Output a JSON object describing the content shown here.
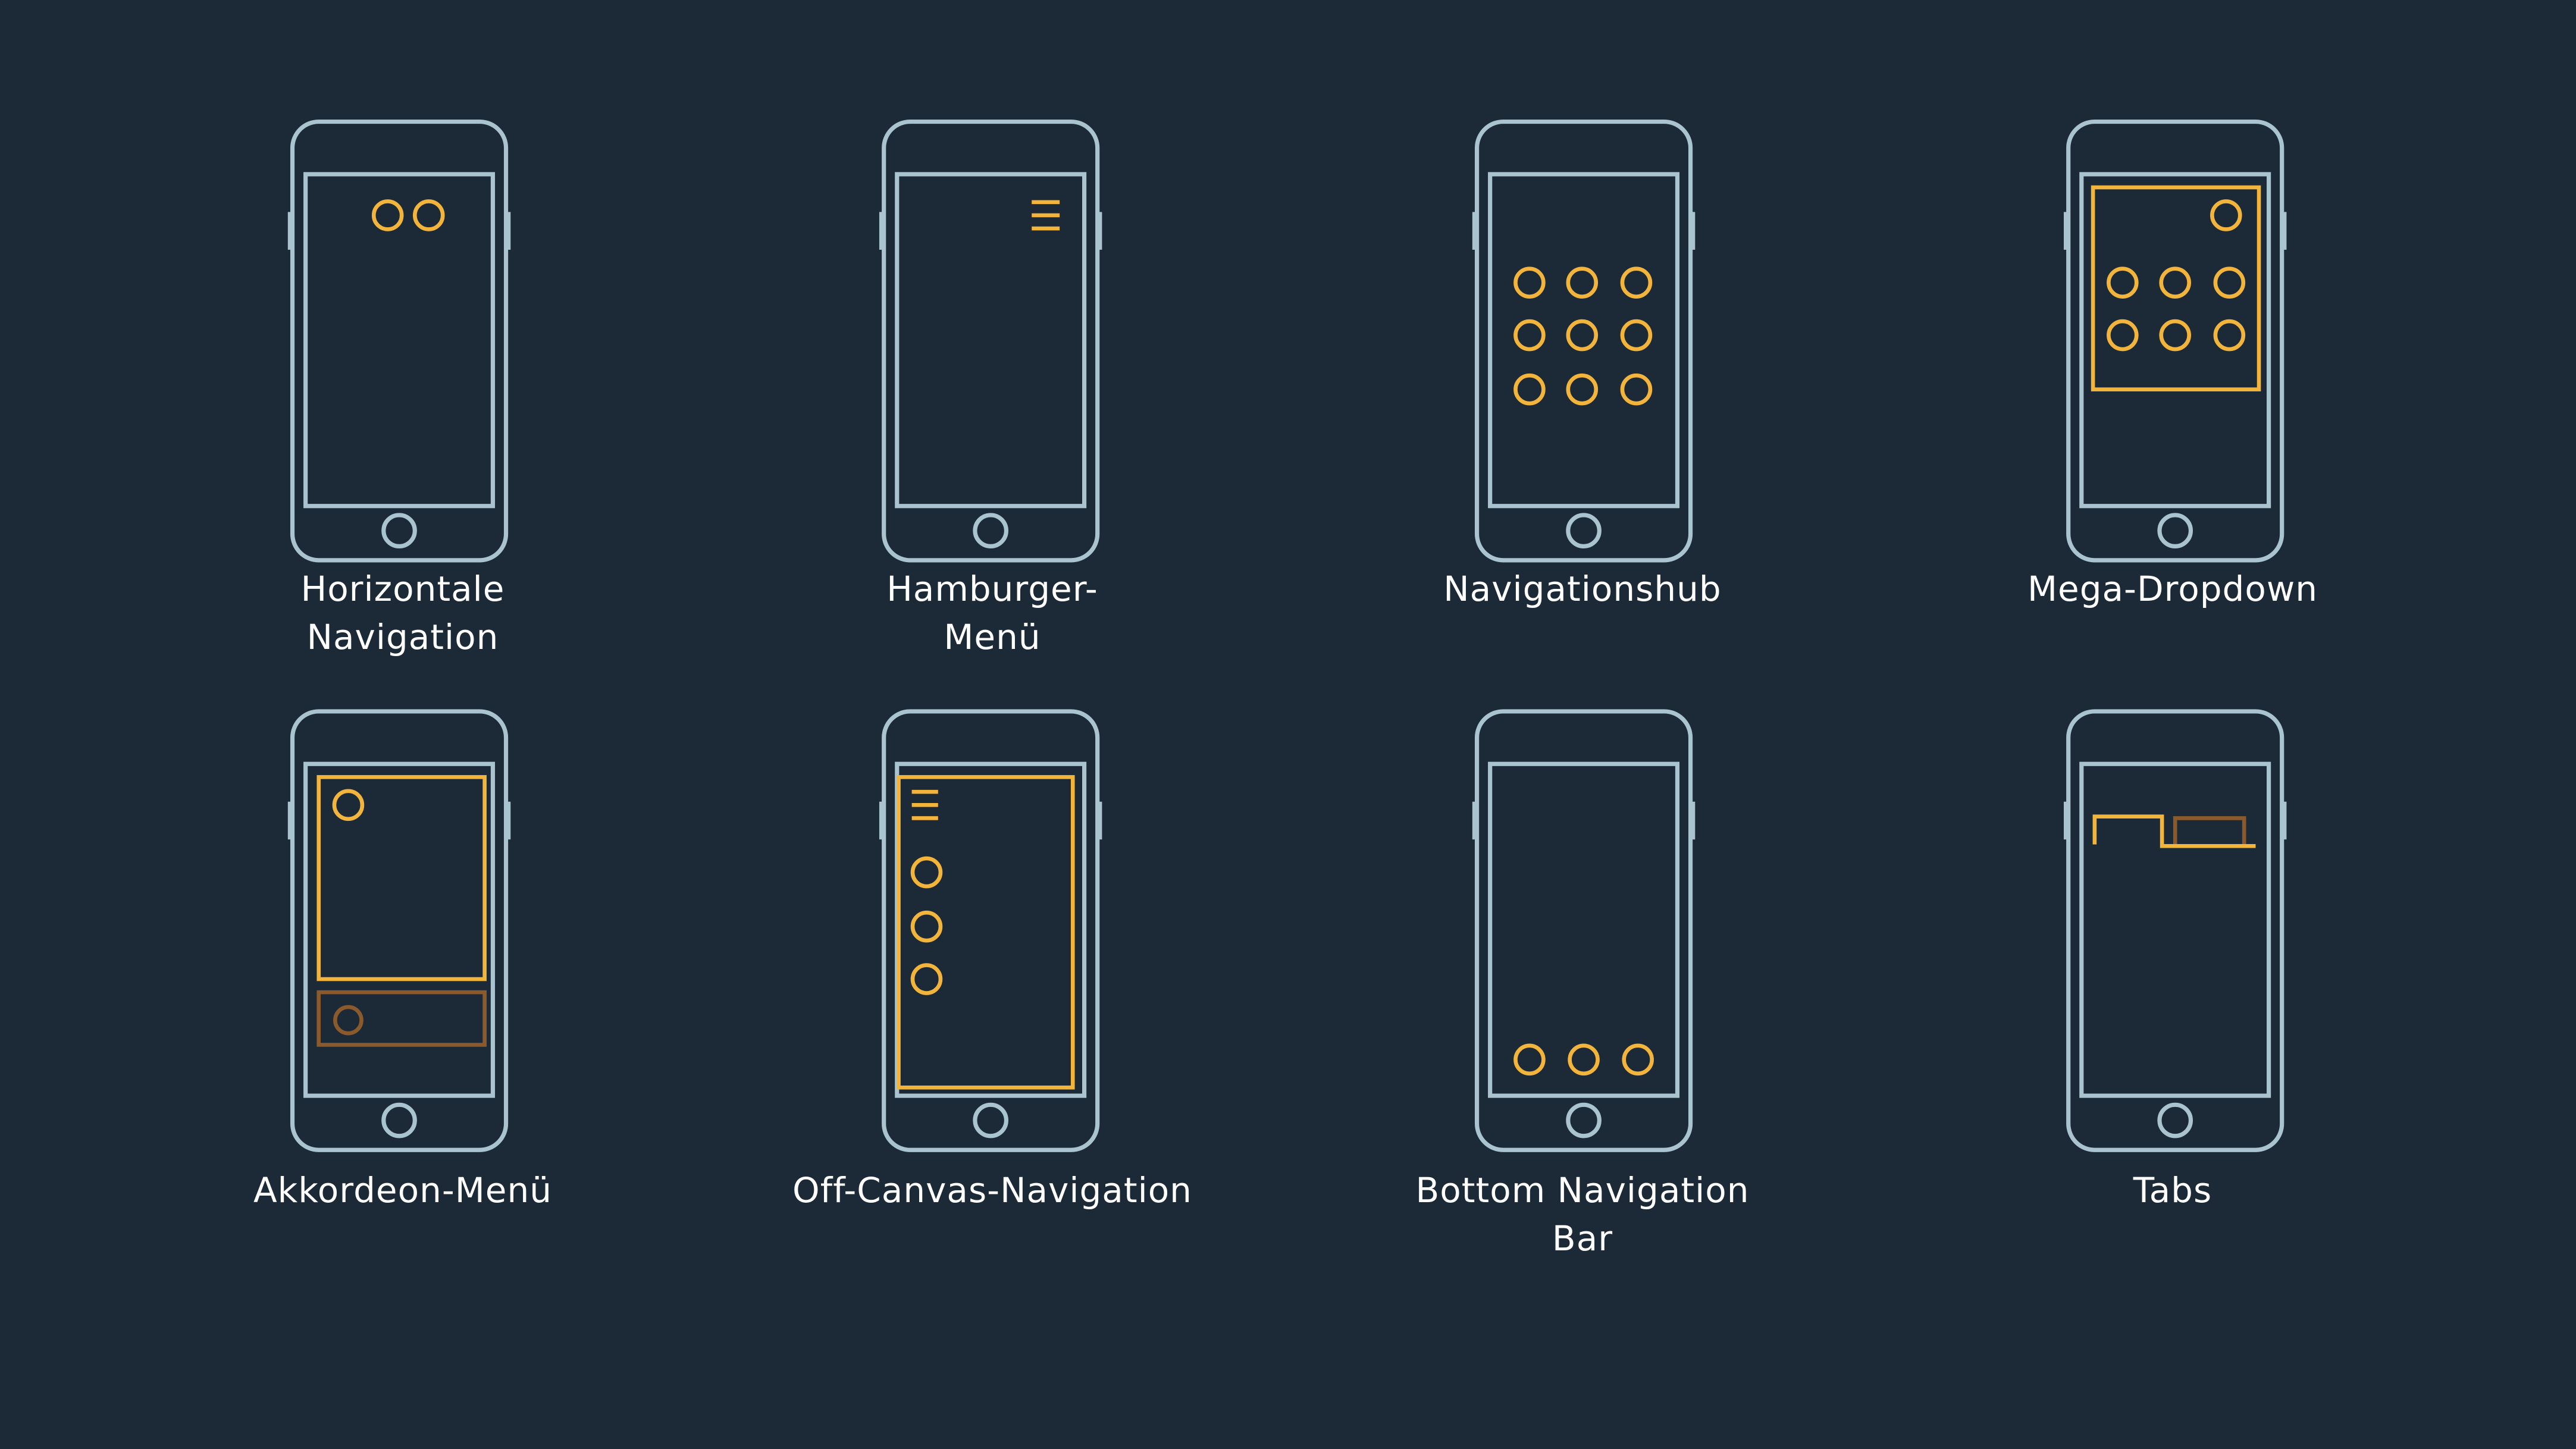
{
  "colors": {
    "background": "#1c2936",
    "phone_outline": "#a9c4cf",
    "accent": "#f2b43a",
    "accent_dim": "#8a5a2c"
  },
  "patterns": [
    {
      "label": "Horizontale\nNavigation",
      "icon": "horizontal-navigation-phone-icon"
    },
    {
      "label": "Hamburger-\nMenü",
      "icon": "hamburger-menu-phone-icon"
    },
    {
      "label": "Navigationshub",
      "icon": "navigation-hub-phone-icon"
    },
    {
      "label": "Mega-Dropdown",
      "icon": "mega-dropdown-phone-icon"
    },
    {
      "label": "Akkordeon-Menü",
      "icon": "accordion-menu-phone-icon"
    },
    {
      "label": "Off-Canvas-Navigation",
      "icon": "off-canvas-navigation-phone-icon"
    },
    {
      "label": "Bottom Navigation\nBar",
      "icon": "bottom-navigation-bar-phone-icon"
    },
    {
      "label": "Tabs",
      "icon": "tabs-phone-icon"
    }
  ]
}
